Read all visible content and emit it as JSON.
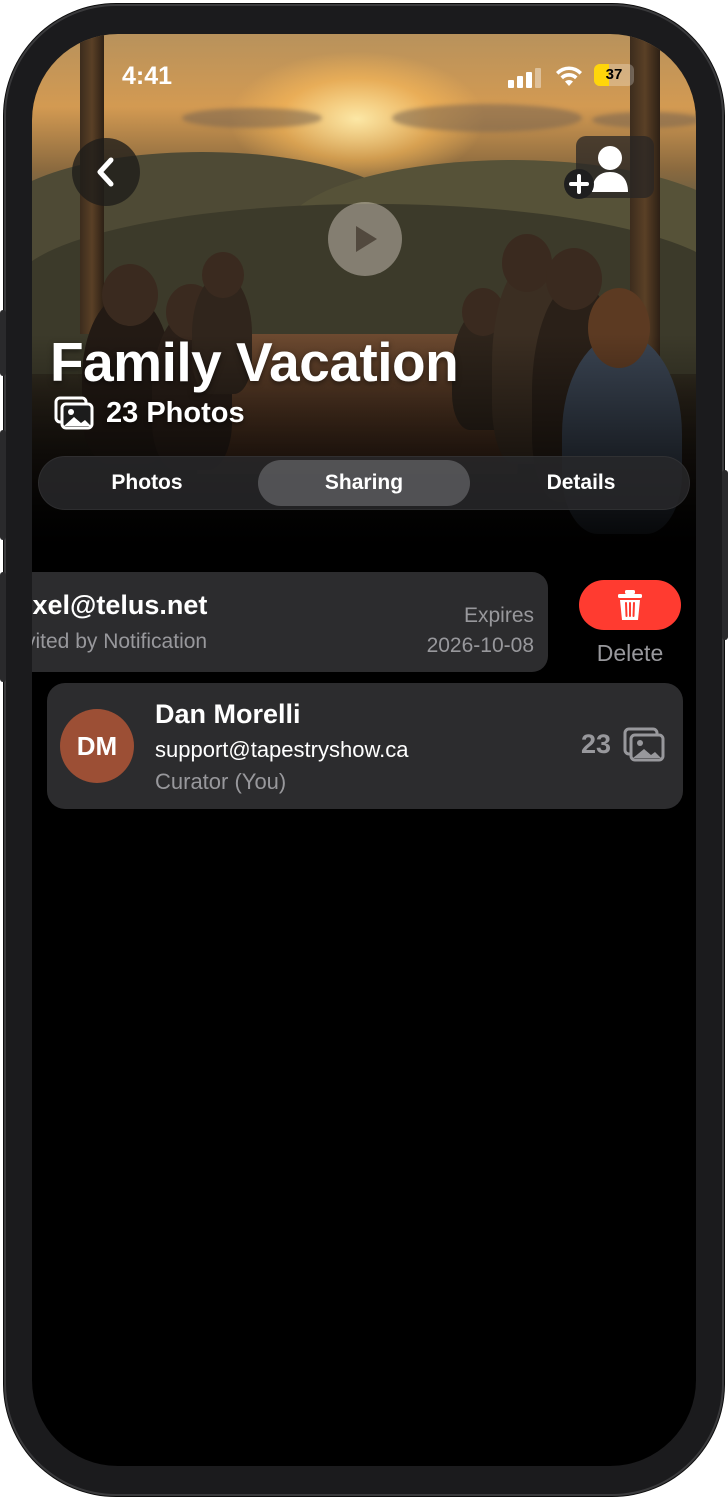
{
  "status_bar": {
    "time": "4:41",
    "battery": "37",
    "battery_level": 0.37
  },
  "album": {
    "title": "Family Vacation",
    "photo_count": "23 Photos"
  },
  "tabs": [
    {
      "label": "Photos",
      "active": false
    },
    {
      "label": "Sharing",
      "active": true
    },
    {
      "label": "Details",
      "active": false
    }
  ],
  "invite_row": {
    "email": "ixel@telus.net",
    "invited_by": "vited by Notification",
    "expires_label": "Expires",
    "expires_date": "2026-10-08",
    "delete_label": "Delete"
  },
  "member_row": {
    "initials": "DM",
    "name": "Dan Morelli",
    "email": "support@tapestryshow.ca",
    "role": "Curator  (You)",
    "photo_count": "23"
  },
  "colors": {
    "delete": "#ff3b30",
    "avatar": "#9c4f35",
    "row_background": "#2c2c2e",
    "battery": "#ffd60a"
  },
  "icons": {
    "back": "chevron-left-icon",
    "add_user": "add-person-icon",
    "play": "play-icon",
    "photos": "photo-stack-icon",
    "delete": "trash-icon"
  }
}
